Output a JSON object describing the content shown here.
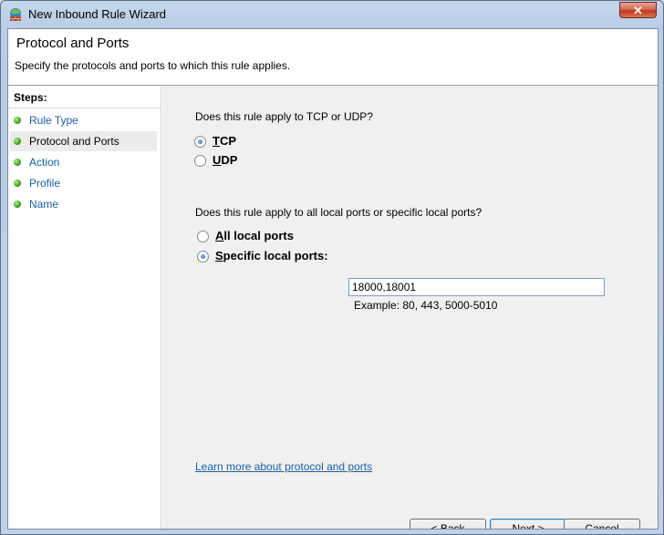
{
  "window": {
    "title": "New Inbound Rule Wizard",
    "close_label": "✕"
  },
  "header": {
    "title": "Protocol and Ports",
    "description": "Specify the protocols and ports to which this rule applies."
  },
  "steps": {
    "title": "Steps:",
    "items": [
      {
        "label": "Rule Type"
      },
      {
        "label": "Protocol and Ports"
      },
      {
        "label": "Action"
      },
      {
        "label": "Profile"
      },
      {
        "label": "Name"
      }
    ],
    "current_index": 1
  },
  "protocol": {
    "question": "Does this rule apply to TCP or UDP?",
    "options": [
      {
        "key": "T",
        "rest": "CP",
        "checked": true
      },
      {
        "key": "U",
        "rest": "DP",
        "checked": false
      }
    ]
  },
  "ports": {
    "question": "Does this rule apply to all local ports or specific local ports?",
    "all_key": "A",
    "all_rest": "ll local ports",
    "specific_key": "S",
    "specific_rest": "pecific local ports:",
    "selected": "specific",
    "value": "18000,18001",
    "example": "Example: 80, 443, 5000-5010"
  },
  "learn_more": "Learn more about protocol and ports",
  "buttons": {
    "back_prefix": "< ",
    "back_key": "B",
    "back_rest": "ack",
    "next_key": "N",
    "next_rest": "ext >",
    "cancel": "Cancel"
  },
  "colors": {
    "link": "#1a5fa8",
    "step_dot": "#3aa31a"
  }
}
